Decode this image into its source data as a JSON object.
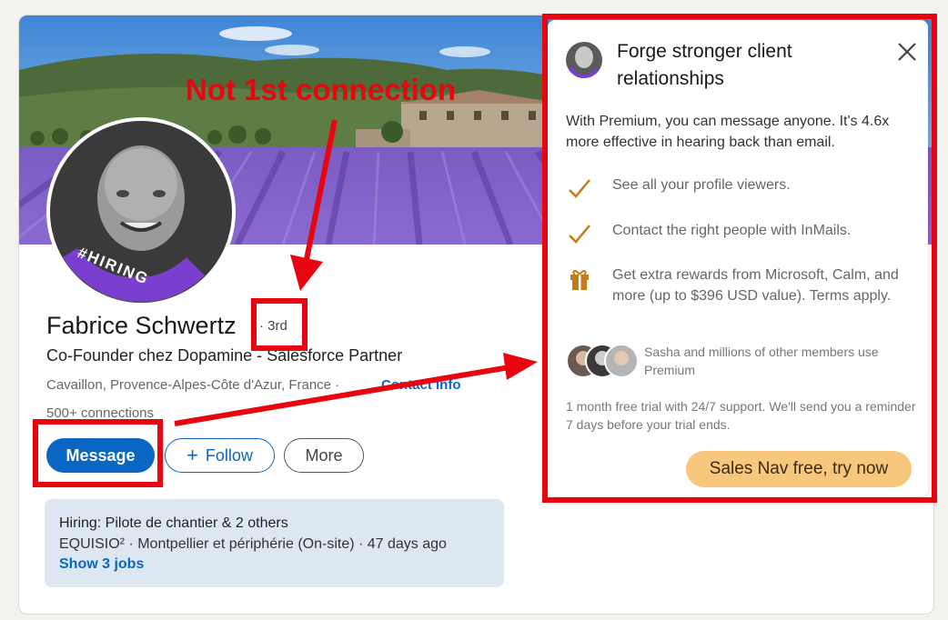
{
  "profile": {
    "name": "Fabrice Schwertz",
    "degree": "· 3rd",
    "headline": "Co-Founder chez Dopamine - Salesforce Partner",
    "location": "Cavaillon, Provence-Alpes-Côte d'Azur, France ·",
    "contact_info": "Contact info",
    "connections": "500+ connections",
    "avatar_badge": "#HIRING"
  },
  "actions": {
    "message": "Message",
    "follow": "Follow",
    "more": "More"
  },
  "hiring": {
    "title": "Hiring: Pilote de chantier & 2 others",
    "subtitle": "EQUISIO² · Montpellier et périphérie (On-site) · 47 days ago",
    "link": "Show 3 jobs"
  },
  "premium_popup": {
    "title": "Forge stronger client relationships",
    "description": "With Premium, you can message anyone. It's 4.6x more effective in hearing back than email.",
    "features": [
      {
        "icon": "check-icon",
        "text": "See all your profile viewers."
      },
      {
        "icon": "check-icon",
        "text": "Contact the right people with InMails."
      },
      {
        "icon": "gift-icon",
        "text": "Get extra rewards from Microsoft, Calm, and more (up to $396 USD value). Terms apply."
      }
    ],
    "social_proof": "Sasha and millions of other members use Premium",
    "trial_note": "1 month free trial with 24/7 support. We'll send you a reminder 7 days before your trial ends.",
    "cta": "Sales Nav free, try now"
  },
  "annotation": {
    "label": "Not 1st connection",
    "color": "#e8050f"
  },
  "colors": {
    "linkedin_blue": "#0a66c2",
    "premium_gold": "#f8c77e",
    "check_gold": "#c37d16",
    "hiring_purple": "#7b3fd0"
  }
}
